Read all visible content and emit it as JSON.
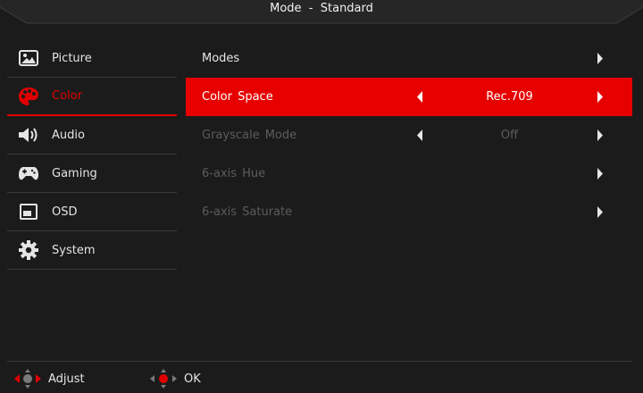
{
  "header": {
    "title": "Mode  -  Standard"
  },
  "colors": {
    "accent": "#e60000",
    "background": "#1b1b1b",
    "disabled_text": "#5c5c5c"
  },
  "sidebar": {
    "items": [
      {
        "label": "Picture",
        "icon": "picture-icon",
        "active": false
      },
      {
        "label": "Color",
        "icon": "palette-icon",
        "active": true
      },
      {
        "label": "Audio",
        "icon": "speaker-icon",
        "active": false
      },
      {
        "label": "Gaming",
        "icon": "gamepad-icon",
        "active": false
      },
      {
        "label": "OSD",
        "icon": "osd-icon",
        "active": false
      },
      {
        "label": "System",
        "icon": "gear-icon",
        "active": false
      }
    ]
  },
  "menu": {
    "rows": [
      {
        "label": "Modes",
        "value": "",
        "state": "normal",
        "left_arrow": false
      },
      {
        "label": "Color  Space",
        "value": "Rec.709",
        "state": "selected",
        "left_arrow": true
      },
      {
        "label": "Grayscale  Mode",
        "value": "Off",
        "state": "disabled",
        "left_arrow": true
      },
      {
        "label": "6-axis  Hue",
        "value": "",
        "state": "disabled",
        "left_arrow": false
      },
      {
        "label": "6-axis  Saturate",
        "value": "",
        "state": "disabled",
        "left_arrow": false
      }
    ]
  },
  "footer": {
    "adjust_label": "Adjust",
    "ok_label": "OK"
  }
}
